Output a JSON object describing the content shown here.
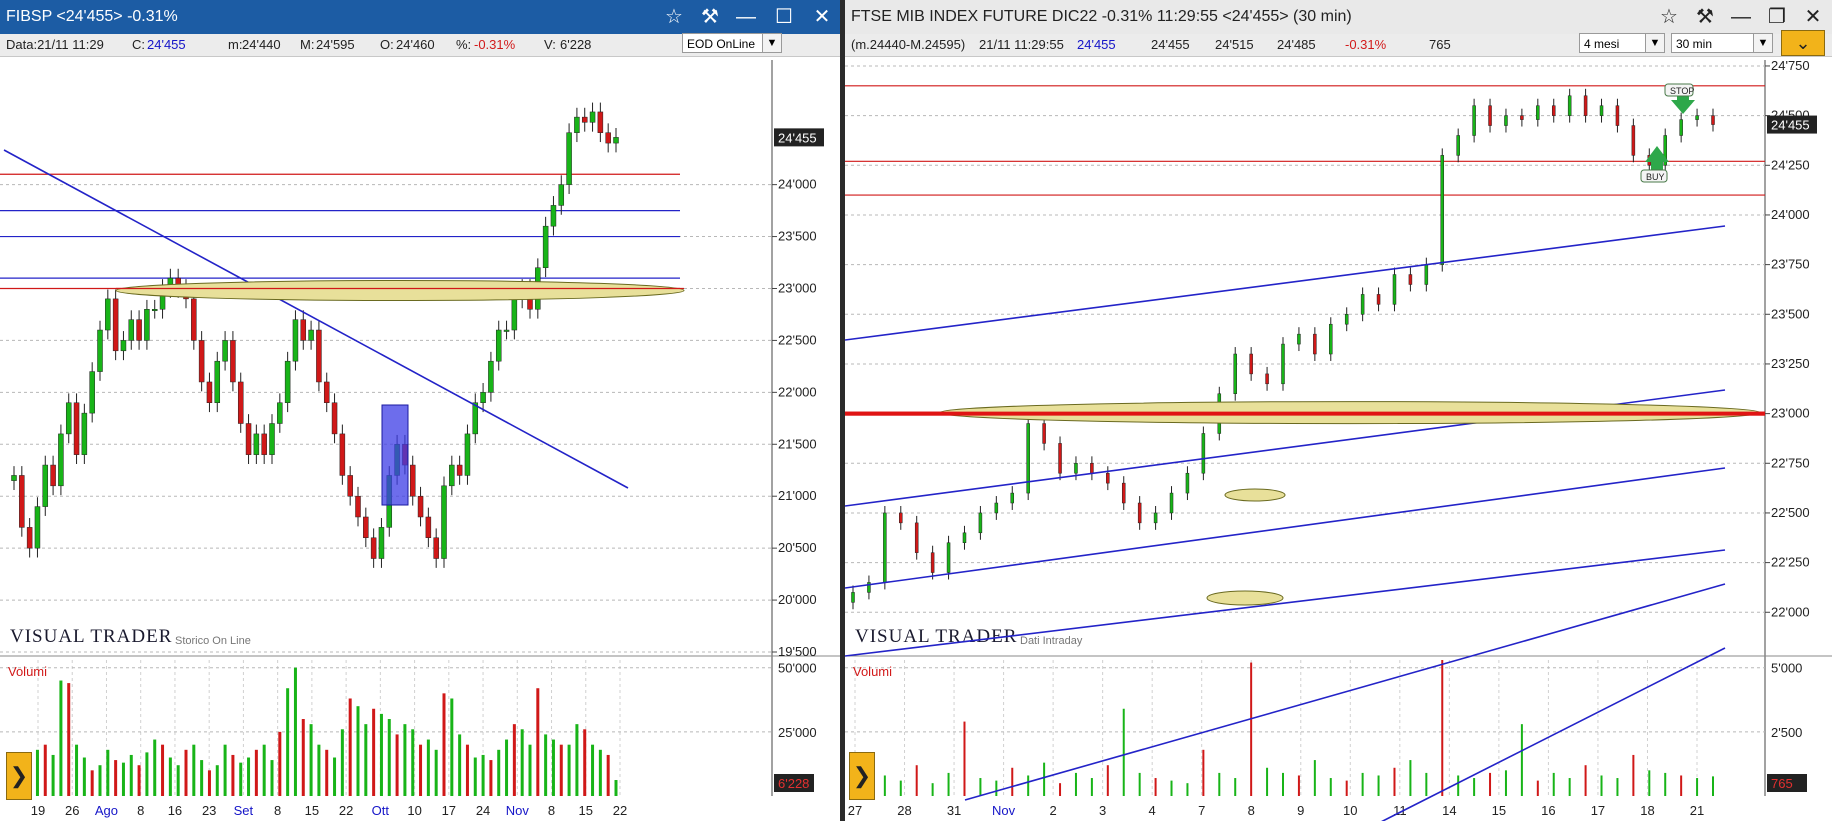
{
  "left": {
    "title": "FIBSP <24'455> -0.31%",
    "info": {
      "data": "Data:21/11 11:29",
      "c_label": "C:",
      "c_val": "24'455",
      "m_label": "m:",
      "m_val": "24'440",
      "M_label": "M:",
      "M_val": "24'595",
      "o_label": "O:",
      "o_val": "24'460",
      "pct_label": "%:",
      "pct_val": "-0.31%",
      "v_label": "V:",
      "v_val": "6'228"
    },
    "eod_combo": "EOD OnLine",
    "brand": "VISUAL TRADER",
    "brand_sub": "Storico On Line",
    "volume_label": "Volumi",
    "last_price_tag": "24'455",
    "last_volume_tag": "6'228"
  },
  "right": {
    "title": "FTSE MIB INDEX FUTURE DIC22 -0.31% 11:29:55  <24'455> (30 min)",
    "info": {
      "range": "(m.24440-M.24595)",
      "datetime": "21/11 11:29:55",
      "last": "24'455",
      "v1": "24'455",
      "v2": "24'515",
      "v3": "24'485",
      "pct": "-0.31%",
      "vol": "765"
    },
    "period_combo": "4 mesi",
    "interval_combo": "30 min",
    "brand": "VISUAL TRADER",
    "brand_sub": "Dati Intraday",
    "volume_label": "Volumi",
    "last_price_tag": "24'455",
    "last_volume_tag": "765",
    "stop_label": "STOP",
    "buy_label": "BUY"
  },
  "colors": {
    "up": "#18b418",
    "down": "#d01818",
    "trendline": "#2323c8",
    "support": "#d01818",
    "zone_fill": "#e8e09a",
    "zone_stroke": "#6a6a20",
    "signal": "#2ea84a"
  },
  "chart_data": [
    {
      "type": "candlestick",
      "title": "FIBSP <24'455> -0.31%",
      "ylim": [
        19500,
        25200
      ],
      "y_ticks": [
        "24'000",
        "23'500",
        "23'000",
        "22'500",
        "22'000",
        "21'500",
        "21'000",
        "20'500",
        "20'000",
        "19'500"
      ],
      "y_tick_values": [
        24000,
        23500,
        23000,
        22500,
        22000,
        21500,
        21000,
        20500,
        20000,
        19500
      ],
      "x_ticks": [
        "19",
        "26",
        "Ago",
        "8",
        "16",
        "23",
        "Set",
        "8",
        "15",
        "22",
        "Ott",
        "10",
        "17",
        "24",
        "Nov",
        "8",
        "15",
        "22"
      ],
      "x_month_ticks": [
        "Ago",
        "Set",
        "Ott",
        "Nov"
      ],
      "series": [
        {
          "name": "FIBSP",
          "close": [
            21200,
            20700,
            20500,
            20900,
            21300,
            21100,
            21600,
            21900,
            21400,
            21800,
            22200,
            22600,
            22900,
            22400,
            22500,
            22700,
            22500,
            22800,
            22800,
            23000,
            23100,
            23000,
            22900,
            22500,
            22100,
            21900,
            22300,
            22500,
            22100,
            21700,
            21400,
            21600,
            21400,
            21700,
            21900,
            22300,
            22700,
            22500,
            22600,
            22100,
            21900,
            21600,
            21200,
            21000,
            20800,
            20600,
            20400,
            20700,
            21200,
            21500,
            21300,
            21000,
            20800,
            20600,
            20400,
            21100,
            21300,
            21200,
            21600,
            21900,
            22000,
            22300,
            22600,
            22600,
            22900,
            23000,
            22800,
            23200,
            23600,
            23800,
            24000,
            24500,
            24650,
            24600,
            24700,
            24500,
            24400,
            24455
          ]
        },
        {
          "name": "Volumi",
          "values": [
            15000,
            12000,
            14000,
            18000,
            20000,
            16000,
            45000,
            44000,
            20000,
            15000,
            10000,
            12000,
            18000,
            14000,
            13000,
            16000,
            12000,
            17000,
            22000,
            20000,
            15000,
            12000,
            18000,
            20000,
            14000,
            10000,
            12000,
            20000,
            16000,
            13000,
            15000,
            18000,
            20000,
            14000,
            25000,
            42000,
            50000,
            30000,
            28000,
            20000,
            18000,
            15000,
            26000,
            38000,
            35000,
            28000,
            34000,
            32000,
            30000,
            24000,
            28000,
            26000,
            20000,
            22000,
            18000,
            40000,
            38000,
            24000,
            20000,
            15000,
            16000,
            14000,
            18000,
            22000,
            28000,
            26000,
            20000,
            42000,
            24000,
            22000,
            20000,
            20000,
            28000,
            26000,
            20000,
            18000,
            16000,
            6228
          ]
        }
      ],
      "horizontal_lines": [
        24100,
        23750,
        23500,
        23100,
        23000
      ],
      "last_price": 24455,
      "volume_ticks": [
        "50'000",
        "25'000"
      ],
      "volume_tick_values": [
        50000,
        25000
      ]
    },
    {
      "type": "candlestick",
      "title": "FTSE MIB INDEX FUTURE DIC22 -0.31% 11:29:55 <24'455> (30 min)",
      "ylim": [
        21800,
        24780
      ],
      "y_ticks": [
        "24'750",
        "24'500",
        "24'250",
        "24'000",
        "23'750",
        "23'500",
        "23'250",
        "23'000",
        "22'750",
        "22'500",
        "22'250",
        "22'000"
      ],
      "y_tick_values": [
        24750,
        24500,
        24250,
        24000,
        23750,
        23500,
        23250,
        23000,
        22750,
        22500,
        22250,
        22000
      ],
      "x_ticks": [
        "27",
        "28",
        "31",
        "Nov",
        "2",
        "3",
        "4",
        "7",
        "8",
        "9",
        "10",
        "11",
        "14",
        "15",
        "16",
        "17",
        "18",
        "21"
      ],
      "x_month_ticks": [
        "Nov"
      ],
      "series": [
        {
          "name": "FTSE MIB FUT",
          "close": [
            22100,
            22150,
            22500,
            22450,
            22300,
            22200,
            22350,
            22400,
            22500,
            22550,
            22600,
            22950,
            22850,
            22700,
            22750,
            22700,
            22650,
            22550,
            22450,
            22500,
            22600,
            22700,
            22900,
            23100,
            23300,
            23200,
            23150,
            23350,
            23400,
            23300,
            23450,
            23500,
            23600,
            23550,
            23700,
            23650,
            23750,
            24300,
            24400,
            24550,
            24450,
            24500,
            24480,
            24550,
            24500,
            24600,
            24500,
            24550,
            24450,
            24300,
            24250,
            24400,
            24480,
            24500,
            24455
          ]
        },
        {
          "name": "Volumi",
          "values": [
            300,
            1500,
            800,
            600,
            1200,
            500,
            900,
            2900,
            700,
            600,
            1100,
            800,
            1300,
            500,
            900,
            700,
            1200,
            3400,
            900,
            700,
            600,
            500,
            1800,
            900,
            700,
            5200,
            1100,
            900,
            800,
            1400,
            700,
            600,
            900,
            800,
            1100,
            1400,
            900,
            5300,
            800,
            700,
            900,
            1000,
            2800,
            600,
            900,
            700,
            1200,
            800,
            700,
            1600,
            1000,
            900,
            800,
            700,
            765
          ]
        }
      ],
      "horizontal_lines": [
        24650,
        24270,
        24100,
        23000
      ],
      "last_price": 24455,
      "annotations": [
        "STOP",
        "BUY"
      ],
      "volume_ticks": [
        "5'000",
        "2'500"
      ],
      "volume_tick_values": [
        5000,
        2500
      ]
    }
  ]
}
